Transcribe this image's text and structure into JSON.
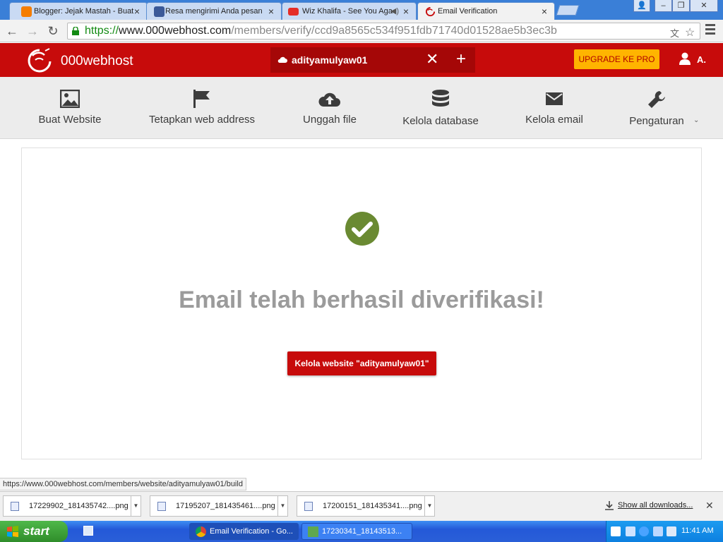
{
  "browser": {
    "tabs": [
      {
        "title": "Blogger: Jejak Mastah - Buat",
        "close": "×",
        "active": false
      },
      {
        "title": "Resa mengirimi Anda pesan",
        "close": "×",
        "active": false
      },
      {
        "title": "Wiz Khalifa - See You Aga",
        "close": "×",
        "active": false
      },
      {
        "title": "Email Verification",
        "close": "×",
        "active": true
      }
    ],
    "url": {
      "scheme": "https://",
      "host": "www.000webhost.com",
      "path": "/members/verify/ccd9a8565c534f951fdb71740d01528ae5b3ec3b"
    }
  },
  "site": {
    "logo_text": "000webhost",
    "current_site": "adityamulyaw01",
    "close_site": "✕",
    "add_site": "+",
    "upgrade_label": "UPGRADE KE PRO",
    "user_label": "A.",
    "brand_color": "#c70b0b"
  },
  "nav": {
    "items": [
      {
        "label": "Buat Website",
        "icon": "image-icon"
      },
      {
        "label": "Tetapkan web address",
        "icon": "flag-icon"
      },
      {
        "label": "Unggah file",
        "icon": "cloud-upload-icon"
      },
      {
        "label": "Kelola database",
        "icon": "database-icon"
      },
      {
        "label": "Kelola email",
        "icon": "envelope-icon"
      },
      {
        "label": "Pengaturan",
        "icon": "wrench-icon"
      }
    ],
    "settings_caret": "⌄"
  },
  "main": {
    "headline": "Email telah berhasil diverifikasi!",
    "button_label": "Kelola website \"adityamulyaw01\"",
    "success_color": "#6a8a32"
  },
  "status_url": "https://www.000webhost.com/members/website/adityamulyaw01/build",
  "downloads": {
    "items": [
      {
        "name": "17229902_181435742....png"
      },
      {
        "name": "17195207_181435461....png"
      },
      {
        "name": "17200151_181435341....png"
      }
    ],
    "show_all": "Show all downloads...",
    "close": "✕"
  },
  "taskbar": {
    "start_label": "start",
    "items": [
      {
        "label": "Email Verification - Go...",
        "active": true
      },
      {
        "label": "17230341_18143513...",
        "active": false
      }
    ],
    "clock": "11:41 AM"
  }
}
